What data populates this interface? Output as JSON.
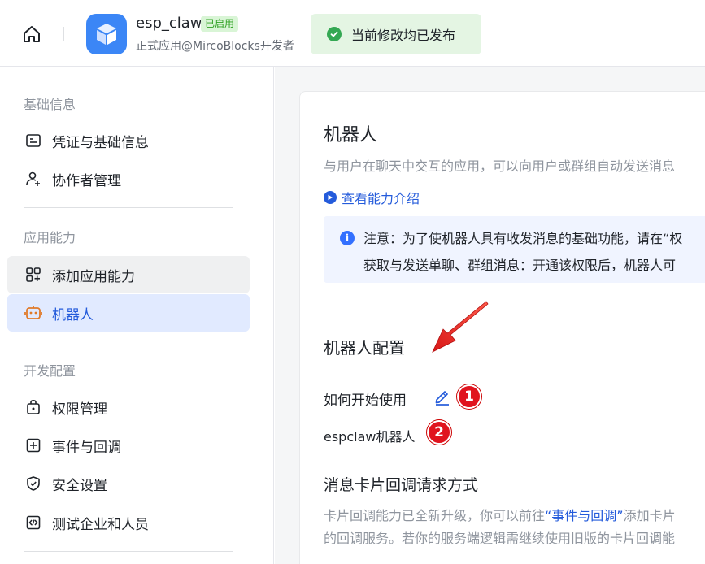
{
  "header": {
    "app_name": "esp_claw",
    "app_badge": "已启用",
    "app_subtitle": "正式应用@MircoBlocks开发者",
    "publish_status": "当前修改均已发布"
  },
  "sidebar": {
    "sections": [
      {
        "title": "基础信息"
      },
      {
        "title": "应用能力"
      },
      {
        "title": "开发配置"
      }
    ],
    "items": [
      {
        "label": "凭证与基础信息",
        "icon": "credential-icon"
      },
      {
        "label": "协作者管理",
        "icon": "user-add-icon"
      },
      {
        "label": "添加应用能力",
        "icon": "add-app-icon"
      },
      {
        "label": "机器人",
        "icon": "robot-icon"
      },
      {
        "label": "权限管理",
        "icon": "lock-icon"
      },
      {
        "label": "事件与回调",
        "icon": "event-icon"
      },
      {
        "label": "安全设置",
        "icon": "shield-icon"
      },
      {
        "label": "测试企业和人员",
        "icon": "code-icon"
      }
    ]
  },
  "main": {
    "title": "机器人",
    "description": "与用户在聊天中交互的应用，可以向用户或群组自动发送消息",
    "intro_link": "查看能力介绍",
    "notice_line1": "注意：为了使机器人具有收发消息的基础功能，请在“权",
    "notice_line2": "获取与发送单聊、群组消息：开通该权限后，机器人可",
    "config_title": "机器人配置",
    "how_to_label": "如何开始使用",
    "bot_name": "espclaw机器人",
    "badge_1": "1",
    "badge_2": "2",
    "callback_title": "消息卡片回调请求方式",
    "callback_para1_pre": "卡片回调能力已全新升级，你可以前往",
    "callback_para1_link": "“事件与回调”",
    "callback_para1_post": "添加卡片",
    "callback_para2": "的回调服务。若你的服务端逻辑需继续使用旧版的卡片回调能"
  },
  "colors": {
    "accent": "#245bdb",
    "active_bg": "#e1eaff",
    "success": "#34a853",
    "badge_red": "#e0141e"
  }
}
